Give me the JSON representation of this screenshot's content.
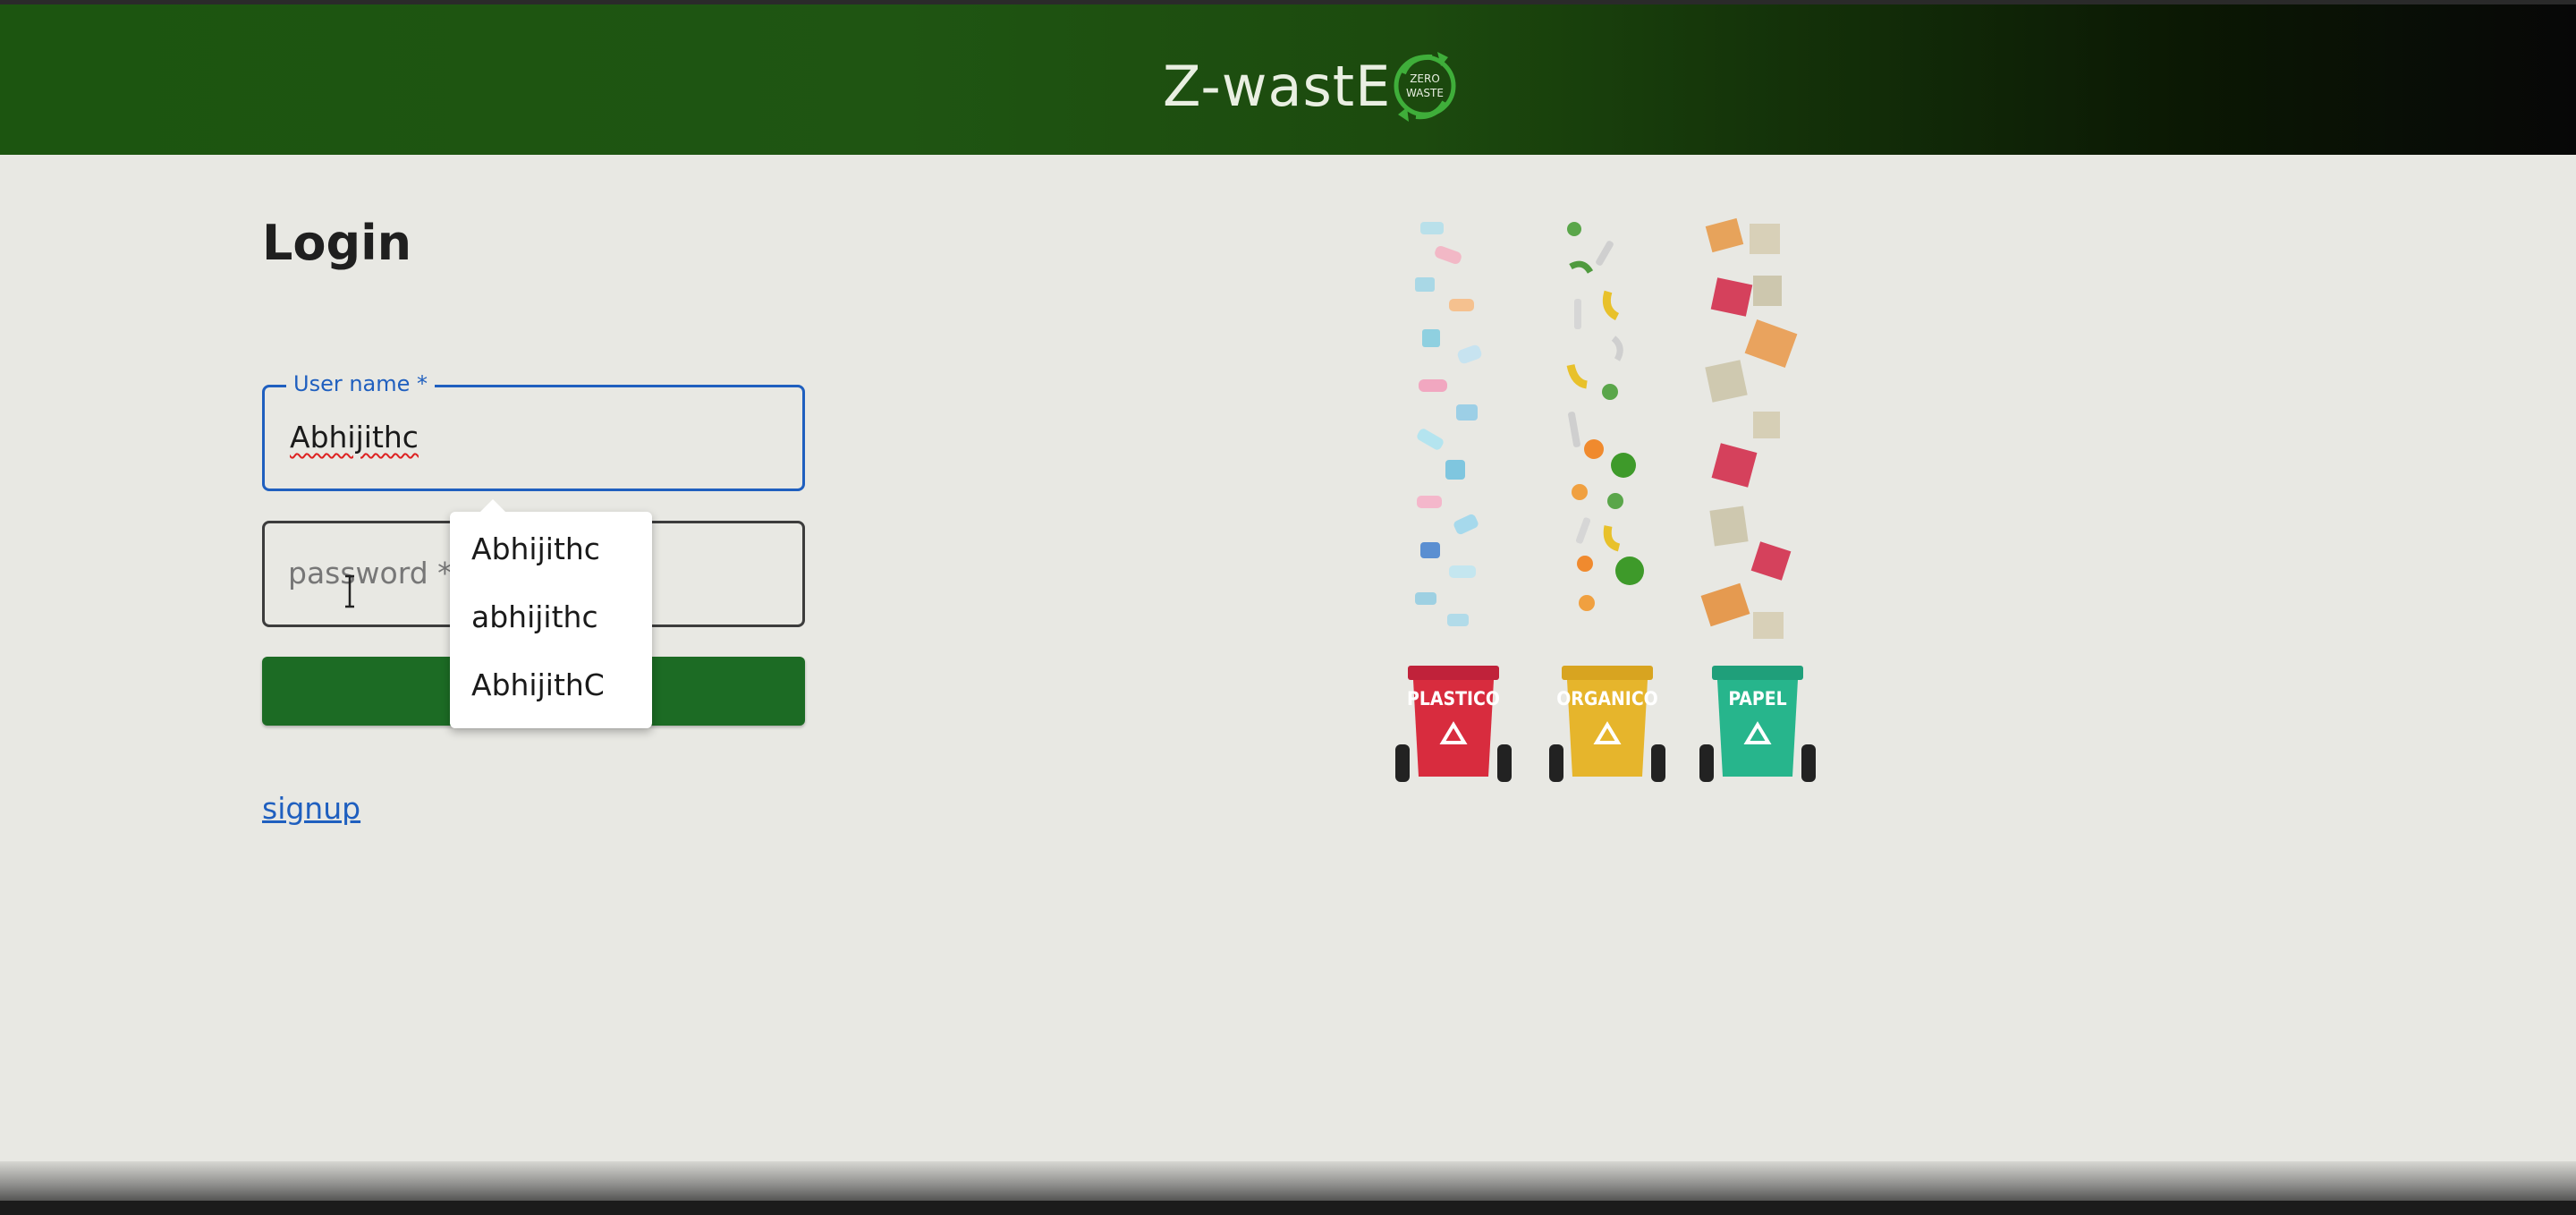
{
  "header": {
    "brand": "Z-wastE",
    "logo_badge_top": "ZERO",
    "logo_badge_bottom": "WASTE"
  },
  "login": {
    "title": "Login",
    "username": {
      "label": "User name *",
      "value": "Abhijithc"
    },
    "password": {
      "placeholder": "password *"
    },
    "signup_link": "signup"
  },
  "autocomplete": {
    "options": [
      "Abhijithc",
      "abhijithc",
      "AbhijithC"
    ]
  },
  "illustration": {
    "bins": [
      "PLASTICO",
      "ORGANICO",
      "PAPEL"
    ]
  },
  "colors": {
    "header_green": "#1c5510",
    "accent_blue": "#1f5fbf",
    "button_green": "#1c6b24",
    "bin_plastic": "#d82c3e",
    "bin_organic": "#e6b52c",
    "bin_paper": "#27b58c"
  }
}
